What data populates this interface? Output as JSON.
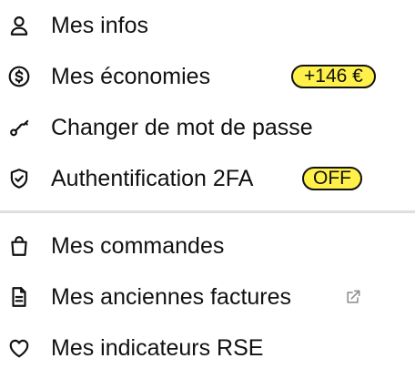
{
  "menu": {
    "items": [
      {
        "label": "Mes infos",
        "icon": "user-icon"
      },
      {
        "label": "Mes économies",
        "icon": "dollar-circle-icon",
        "badge": "+146 €"
      },
      {
        "label": "Changer de mot de passe",
        "icon": "key-icon"
      },
      {
        "label": "Authentification 2FA",
        "icon": "shield-check-icon",
        "badge": "OFF"
      },
      {
        "label": "Mes commandes",
        "icon": "shopping-bag-icon"
      },
      {
        "label": "Mes anciennes factures",
        "icon": "document-icon",
        "trailing_icon": "external-link-icon"
      },
      {
        "label": "Mes indicateurs RSE",
        "icon": "heart-icon"
      }
    ]
  },
  "colors": {
    "text": "#111111",
    "badge_background": "#fff04a",
    "divider": "#dedede",
    "external_link_icon": "#8a8a8a"
  }
}
